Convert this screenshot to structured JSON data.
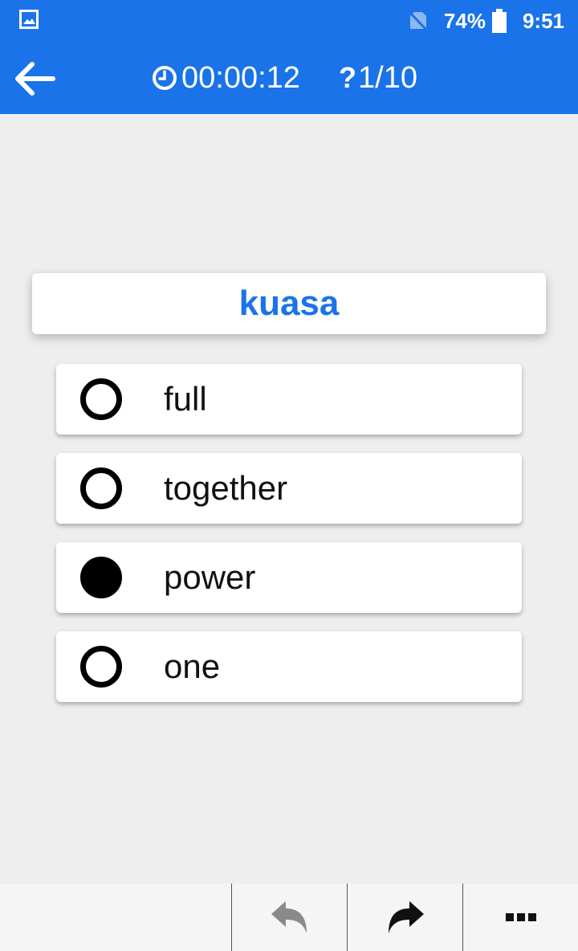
{
  "status_bar": {
    "battery_percent": "74%",
    "time": "9:51",
    "icons": [
      "image-notification-icon",
      "no-sim-icon",
      "battery-icon"
    ]
  },
  "app_bar": {
    "back_icon": "arrow-back-icon",
    "timer": "00:00:12",
    "timer_icon": "clock-icon",
    "progress_mark": "?",
    "progress": "1/10"
  },
  "question": {
    "word": "kuasa"
  },
  "options": [
    {
      "label": "full",
      "selected": false
    },
    {
      "label": "together",
      "selected": false
    },
    {
      "label": "power",
      "selected": true
    },
    {
      "label": "one",
      "selected": false
    }
  ],
  "toolbar": {
    "icons": [
      "undo-icon",
      "redo-icon",
      "more-icon"
    ]
  },
  "colors": {
    "primary": "#1a73e8",
    "background": "#eeeeee",
    "card": "#ffffff",
    "undo_disabled": "#8a8a8a"
  }
}
